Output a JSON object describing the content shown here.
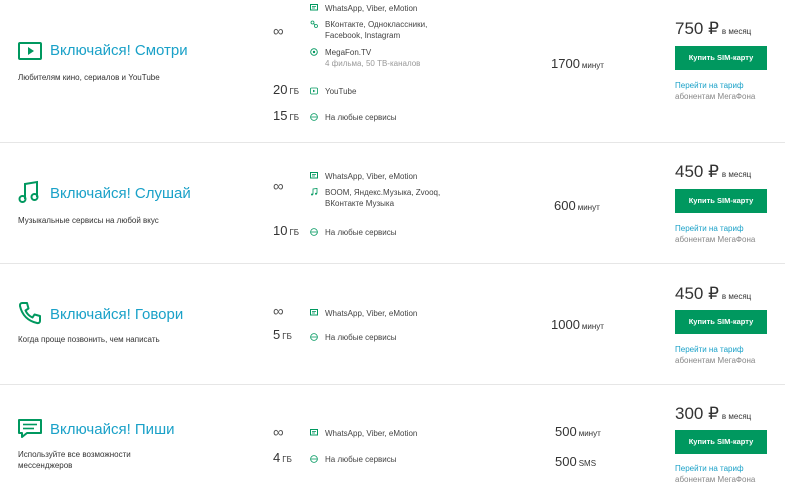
{
  "colors": {
    "accent": "#00985f",
    "link": "#1aa1c8"
  },
  "plans": [
    {
      "icon": "play-icon",
      "name": "Включайся! Смотри",
      "description": "Любителям кино, сериалов и YouTube",
      "unlimited_symbol": "∞",
      "services": [
        {
          "icon": "chat-icon",
          "text": "WhatsApp, Viber, eMotion"
        },
        {
          "icon": "social-icon",
          "text": "ВКонтакте, Одноклассники,"
        },
        {
          "icon": "",
          "text": "Facebook, Instagram"
        },
        {
          "icon": "tv-icon",
          "text": "MegaFon.TV",
          "sub": "4 фильма, 50 ТВ-каналов"
        }
      ],
      "data": [
        {
          "amount": "20",
          "unit": "ГБ",
          "icon": "youtube-icon",
          "label": "YouTube"
        },
        {
          "amount": "15",
          "unit": "ГБ",
          "icon": "globe-icon",
          "label": "На любые сервисы"
        }
      ],
      "minutes": [
        {
          "amount": "1700",
          "unit": "минут"
        }
      ],
      "price": {
        "amount": "750 ₽",
        "period": "в месяц"
      },
      "buy_label": "Купить SIM-карту",
      "switch_label": "Перейти на тариф",
      "subscriber_note": "абонентам МегаФона"
    },
    {
      "icon": "music-icon",
      "name": "Включайся! Слушай",
      "description": "Музыкальные сервисы на любой вкус",
      "unlimited_symbol": "∞",
      "services": [
        {
          "icon": "chat-icon",
          "text": "WhatsApp, Viber, eMotion"
        },
        {
          "icon": "note-icon",
          "text": "BOOM, Яндекс.Музыка, Zvooq,"
        },
        {
          "icon": "",
          "text": "ВКонтакте Музыка"
        }
      ],
      "data": [
        {
          "amount": "10",
          "unit": "ГБ",
          "icon": "globe-icon",
          "label": "На любые сервисы"
        }
      ],
      "minutes": [
        {
          "amount": "600",
          "unit": "минут"
        }
      ],
      "price": {
        "amount": "450 ₽",
        "period": "в месяц"
      },
      "buy_label": "Купить SIM-карту",
      "switch_label": "Перейти на тариф",
      "subscriber_note": "абонентам МегаФона"
    },
    {
      "icon": "phone-icon",
      "name": "Включайся! Говори",
      "description": "Когда проще позвонить, чем написать",
      "unlimited_symbol": "∞",
      "services": [
        {
          "icon": "chat-icon",
          "text": "WhatsApp, Viber, eMotion"
        }
      ],
      "data": [
        {
          "amount": "5",
          "unit": "ГБ",
          "icon": "globe-icon",
          "label": "На любые сервисы"
        }
      ],
      "minutes": [
        {
          "amount": "1000",
          "unit": "минут"
        }
      ],
      "price": {
        "amount": "450 ₽",
        "period": "в месяц"
      },
      "buy_label": "Купить SIM-карту",
      "switch_label": "Перейти на тариф",
      "subscriber_note": "абонентам МегаФона"
    },
    {
      "icon": "message-icon",
      "name": "Включайся! Пиши",
      "description": "Используйте все возможности мессенджеров",
      "unlimited_symbol": "∞",
      "services": [
        {
          "icon": "chat-icon",
          "text": "WhatsApp, Viber, eMotion"
        }
      ],
      "data": [
        {
          "amount": "4",
          "unit": "ГБ",
          "icon": "globe-icon",
          "label": "На любые сервисы"
        }
      ],
      "minutes": [
        {
          "amount": "500",
          "unit": "минут"
        },
        {
          "amount": "500",
          "unit": "SMS"
        }
      ],
      "price": {
        "amount": "300 ₽",
        "period": "в месяц"
      },
      "buy_label": "Купить SIM-карту",
      "switch_label": "Перейти на тариф",
      "subscriber_note": "абонентам МегаФона"
    }
  ]
}
